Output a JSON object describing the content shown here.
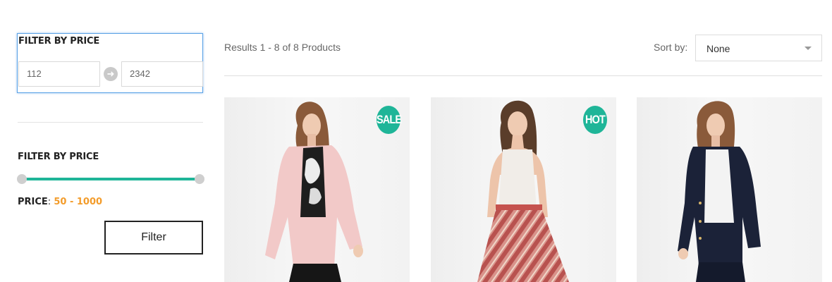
{
  "sidebar": {
    "price_input_filter": {
      "title": "FILTER BY PRICE",
      "min_value": "112",
      "max_value": "2342"
    },
    "price_slider_filter": {
      "title": "FILTER BY PRICE",
      "price_label": "PRICE",
      "price_separator": ":",
      "price_range": "50 - 1000",
      "filter_button": "Filter"
    }
  },
  "toolbar": {
    "results_text": "Results 1 - 8 of 8 Products",
    "sort_label": "Sort by:",
    "sort_value": "None"
  },
  "products": [
    {
      "badge": "SALE"
    },
    {
      "badge": "HOT"
    },
    {
      "badge": ""
    }
  ],
  "colors": {
    "accent": "#1fb598",
    "price_range": "#f39c2b",
    "focus_border": "#5aa2e6"
  }
}
